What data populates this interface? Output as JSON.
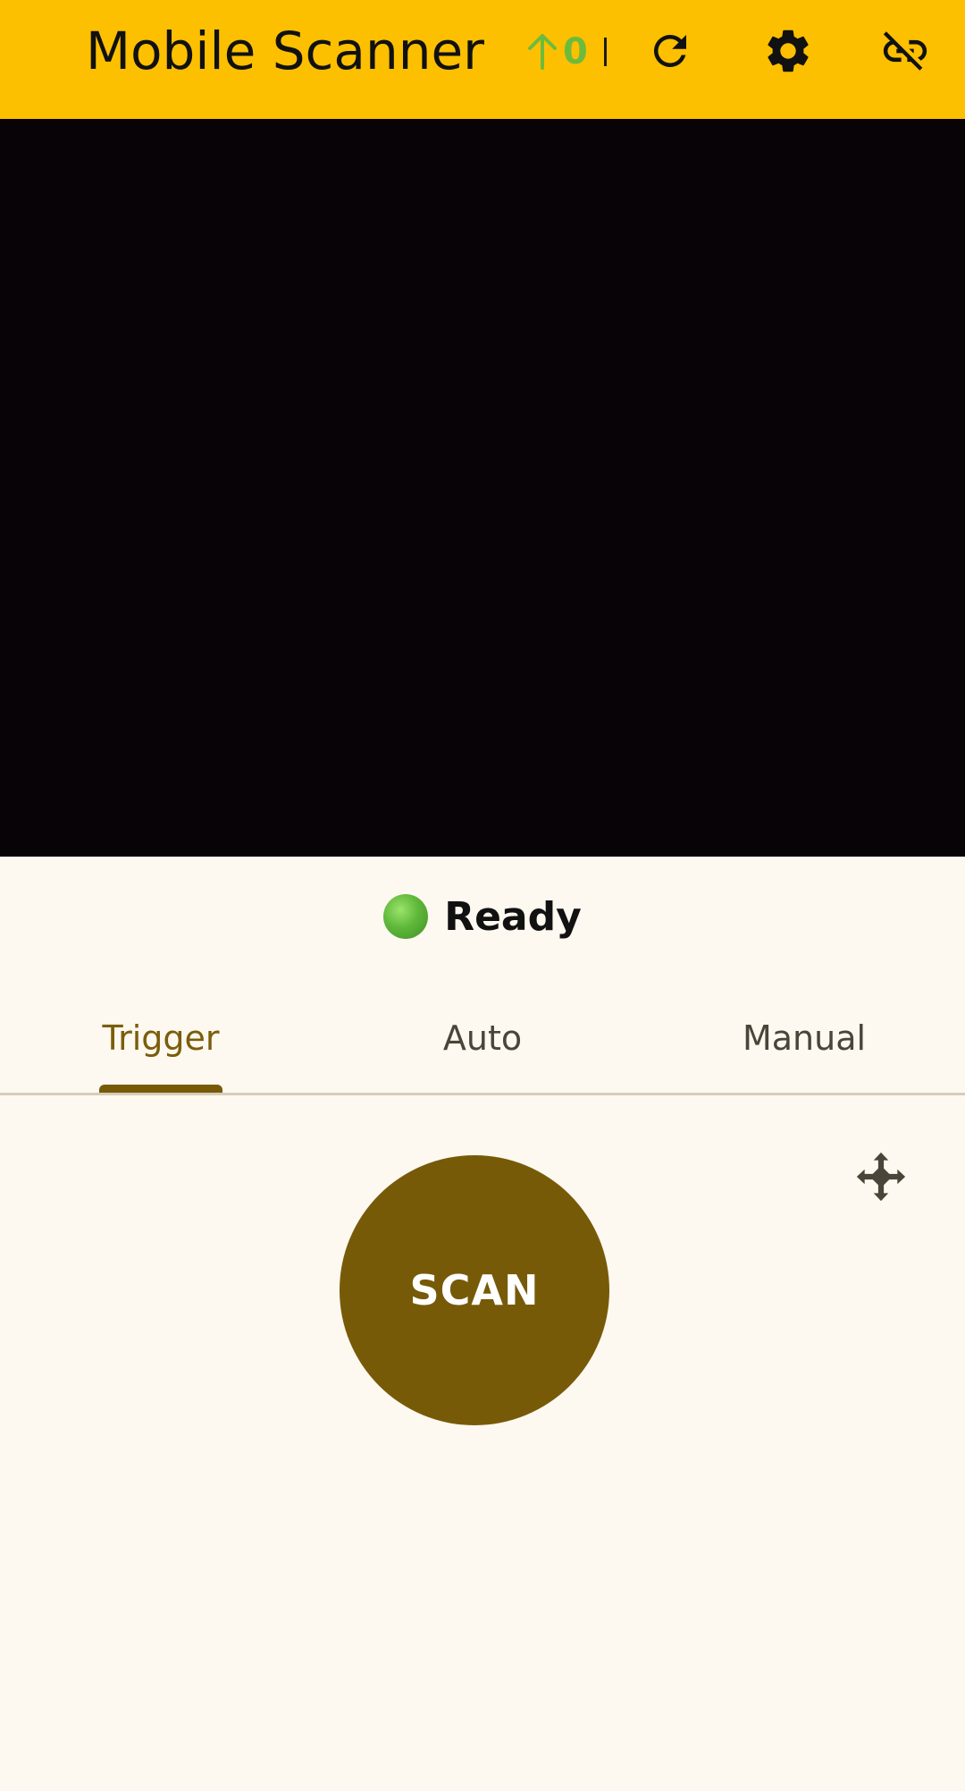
{
  "app_bar": {
    "title": "Mobile Scanner",
    "upload_count": "0",
    "icons": {
      "upload": "arrow-up-icon",
      "refresh": "refresh-icon",
      "settings": "gear-icon",
      "connection": "link-off-icon"
    }
  },
  "status": {
    "text": "Ready",
    "indicator_color": "#5fb83a"
  },
  "tabs": [
    {
      "label": "Trigger",
      "selected": true
    },
    {
      "label": "Auto",
      "selected": false
    },
    {
      "label": "Manual",
      "selected": false
    }
  ],
  "scan_button": {
    "label": "SCAN"
  },
  "move_handle": {
    "icon": "move-arrows-icon"
  },
  "colors": {
    "app_bar": "#fcc000",
    "accent": "#775a08",
    "upload_count": "#6dbb3d",
    "camera_background": "#070307",
    "page_background": "#fdf8f0"
  }
}
